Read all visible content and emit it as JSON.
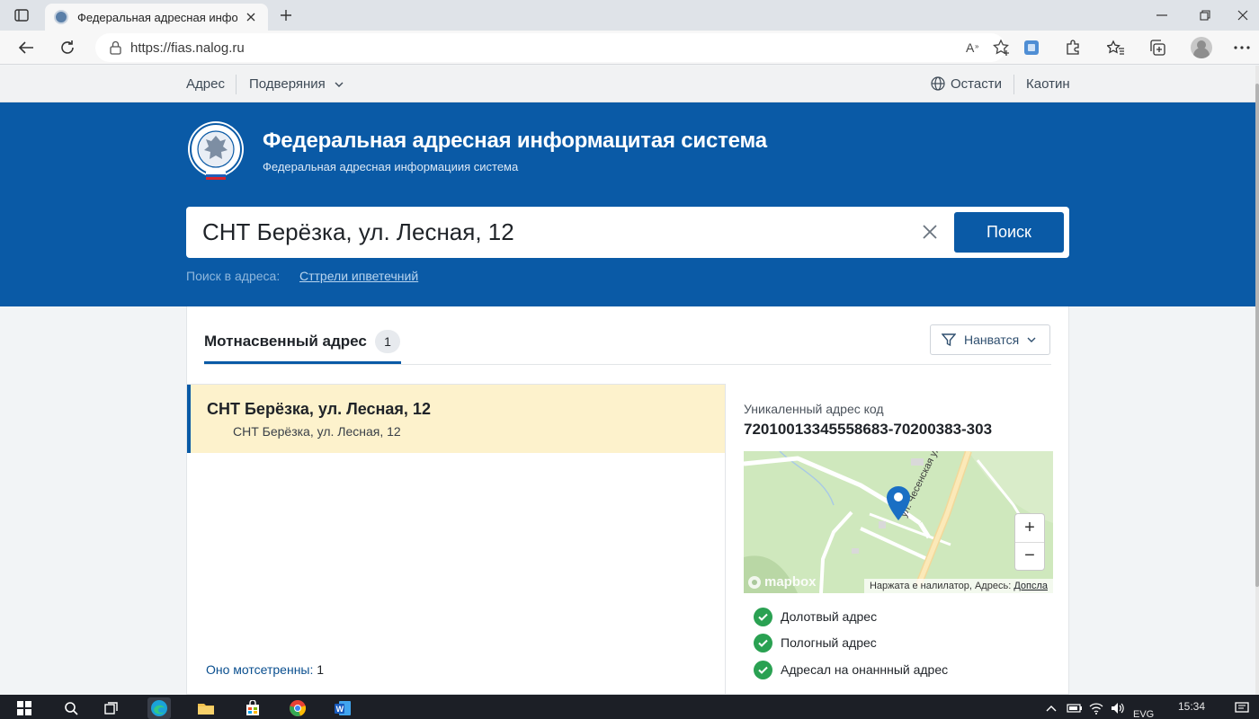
{
  "browser": {
    "tab_title": "Федеральная адресная информ",
    "url": "https://fias.nalog.ru",
    "colors": {
      "chrome": "#f7f7f7",
      "tabbar": "#dfe3e8"
    }
  },
  "site_nav": {
    "address": "Адрес",
    "more": "Подверяния",
    "lang": "Остасти",
    "login": "Каотин"
  },
  "header": {
    "title": "Федеральная адресная информацитая система",
    "subtitle": "Федеральная адресная информациия система",
    "accent": "#0a5aa6"
  },
  "search": {
    "value": "СНТ Берёзка, ул. Лесная, 12",
    "button": "Поиск",
    "hint_label": "Поиск в адреса:",
    "hint_link": "Сттрели ипветечний"
  },
  "results": {
    "tab_label": "Мотнасвенный адрес",
    "count": "1",
    "filter_label": "Нанватся",
    "items": [
      {
        "title": "СНТ Берёзка, ул. Лесная, 12",
        "subtitle": "СНТ Берёзка, ул. Лесная, 12"
      }
    ],
    "footer_label": "Оно мотсетренны:",
    "footer_value": "1"
  },
  "details": {
    "code_label": "Уникаленный адрес код",
    "code_value": "72010013345558683-70200383-303",
    "map": {
      "street_label": "ул. Чесенская ул.",
      "logo": "mapbox",
      "attribution": "Наржата е налилатор, Адресь:",
      "attribution_link": "Допсла",
      "zoom_in": "+",
      "zoom_out": "−"
    },
    "checks": [
      {
        "label": "Долотвый адрес"
      },
      {
        "label": "Пологный адрес"
      },
      {
        "label": "Адресал на онаннный адрес"
      }
    ]
  },
  "taskbar": {
    "lang": "EVG",
    "time": "15:34"
  }
}
